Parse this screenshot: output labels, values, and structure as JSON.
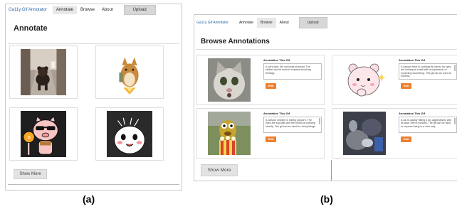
{
  "panel_a": {
    "caption": "(a)",
    "nav": {
      "brand": "Ga11y Gif Annotator",
      "annotate": "Annotate",
      "browse": "Browse",
      "about": "About",
      "upload": "Upload",
      "active": "Annotate"
    },
    "page_title": "Annotate",
    "show_more": "Show More"
  },
  "panel_b": {
    "caption": "(b)",
    "nav": {
      "brand": "Ga11y Gif Annotator",
      "annotate": "Annotate",
      "browse": "Browse",
      "about": "About",
      "upload": "Upload",
      "active": "Browse"
    },
    "page_title": "Browse Annotations",
    "cards": [
      {
        "label": "Annotation This Gif",
        "text": "A cat's face, the cat looks shocked. The sticker can be used to express shocking feelings",
        "edit": "Edit"
      },
      {
        "label": "Annotation This Gif",
        "text": "A cartoon bear is nodding its hands. Its eyes are looking at a wall with a expression of expecting something. This gif can be used to express",
        "edit": "Edit"
      },
      {
        "label": "Annotation This Gif",
        "text": "A cartoon chicken is eating popcorn. The eyes are big balls and the mouth is chewing heavily. The gif can be used for funny things",
        "edit": "Edit"
      },
      {
        "label": "Annotation This Gif",
        "text": "A cat is quickly hitting a toy aggressively with its claw, then it messes. The gif can be used to express being in a cute way",
        "edit": "Edit"
      }
    ],
    "show_more": "Show More"
  },
  "colors": {
    "brand_link": "#2a64a8",
    "edit_button": "#ee7f2d",
    "active_tab": "#e8e8e8",
    "upload_button": "#d7d7d7"
  }
}
